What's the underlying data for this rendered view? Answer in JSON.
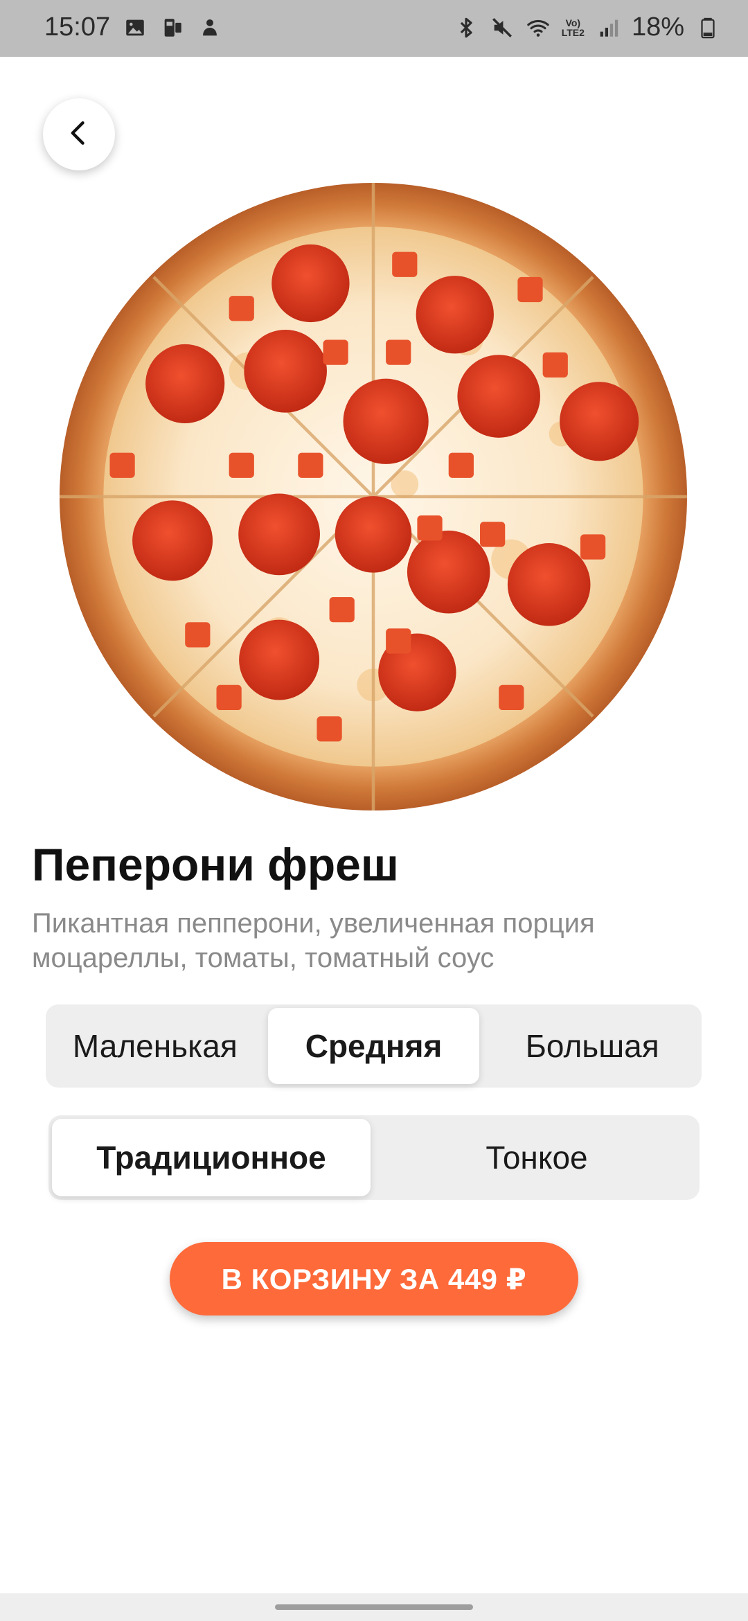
{
  "status_bar": {
    "time": "15:07",
    "battery": "18%",
    "network_label_top": "Vo)",
    "network_label_bottom": "LTE2",
    "icons": [
      "gallery-icon",
      "sim-icon",
      "notification-icon",
      "bluetooth-icon",
      "mute-icon",
      "wifi-icon",
      "signal-icon",
      "battery-icon"
    ]
  },
  "back_button": {
    "icon": "chevron-left-icon"
  },
  "product": {
    "image": "pizza-image",
    "title": "Пеперони фреш",
    "description": "Пикантная пепперони, увеличенная порция моцареллы, томаты, томатный соус"
  },
  "size_selector": {
    "options": [
      "Маленькая",
      "Средняя",
      "Большая"
    ],
    "selected": "Средняя"
  },
  "crust_selector": {
    "options": [
      "Традиционное",
      "Тонкое"
    ],
    "selected": "Традиционное"
  },
  "add_to_cart": {
    "label": "В КОРЗИНУ ЗА 449 ₽"
  },
  "colors": {
    "accent": "#ff6a3a",
    "status_bar_bg": "#bdbdbd",
    "segment_bg": "#eeeeee",
    "description_text": "#8a8a8a"
  }
}
